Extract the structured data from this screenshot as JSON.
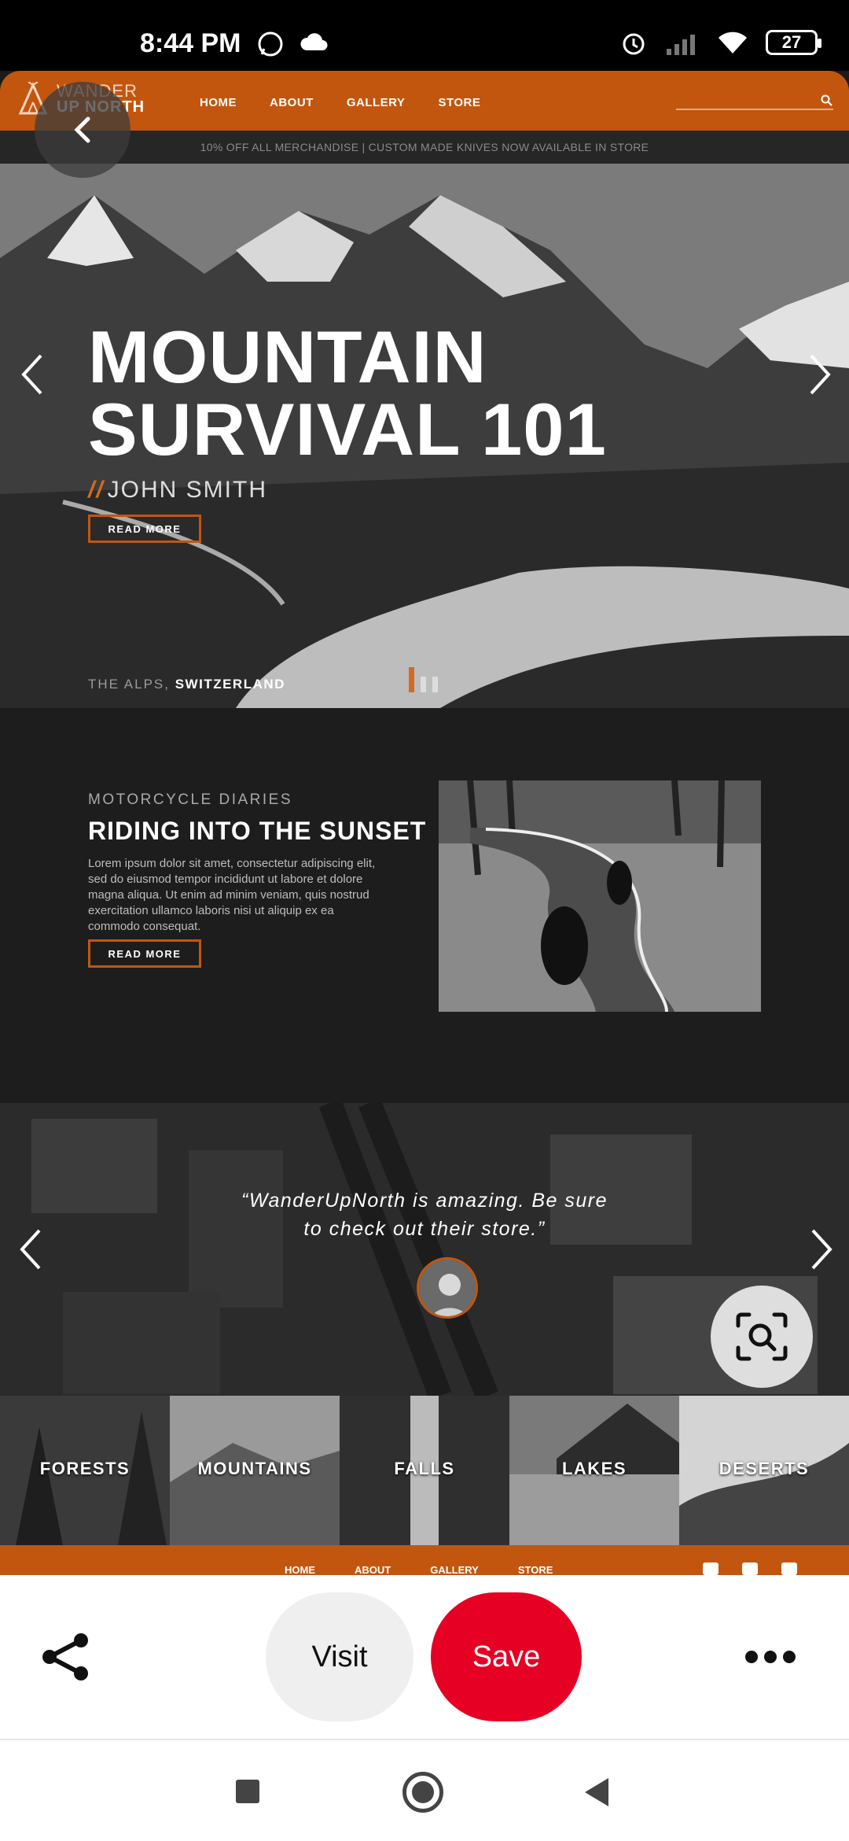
{
  "status_bar": {
    "time": "8:44 PM",
    "battery": "27",
    "icons": [
      "whatsapp-icon",
      "cloud-icon",
      "alarm-icon",
      "signal-icon",
      "wifi-icon",
      "battery-icon"
    ]
  },
  "site": {
    "logo_line1": "WANDER",
    "logo_line2": "UP NORTH",
    "nav": [
      "HOME",
      "ABOUT",
      "GALLERY",
      "STORE"
    ],
    "promo": "10% OFF ALL MERCHANDISE | CUSTOM MADE KNIVES NOW AVAILABLE IN STORE",
    "hero": {
      "title_line1": "MOUNTAIN",
      "title_line2": "SURVIVAL 101",
      "slashes": "//",
      "author": "JOHN SMITH",
      "button": "READ MORE",
      "location_prefix": "THE ALPS,",
      "location": "SWITZERLAND"
    },
    "story": {
      "kicker": "MOTORCYCLE DIARIES",
      "title": "RIDING INTO THE SUNSET",
      "body": "Lorem ipsum dolor sit amet, consectetur adipiscing elit, sed do eiusmod tempor incididunt ut labore et dolore magna aliqua. Ut enim ad minim veniam, quis nostrud exercitation ullamco laboris nisi ut aliquip ex ea commodo consequat.",
      "button": "READ MORE"
    },
    "testimonial": {
      "quote": "“WanderUpNorth is amazing. Be sure to check out their store.”"
    },
    "categories": [
      "FORESTS",
      "MOUNTAINS",
      "FALLS",
      "LAKES",
      "DESERTS"
    ],
    "footer_nav": [
      "HOME",
      "ABOUT",
      "GALLERY",
      "STORE"
    ]
  },
  "actions": {
    "visit": "Visit",
    "save": "Save"
  },
  "colors": {
    "brand_orange": "#c2560f",
    "save_red": "#e60023"
  }
}
